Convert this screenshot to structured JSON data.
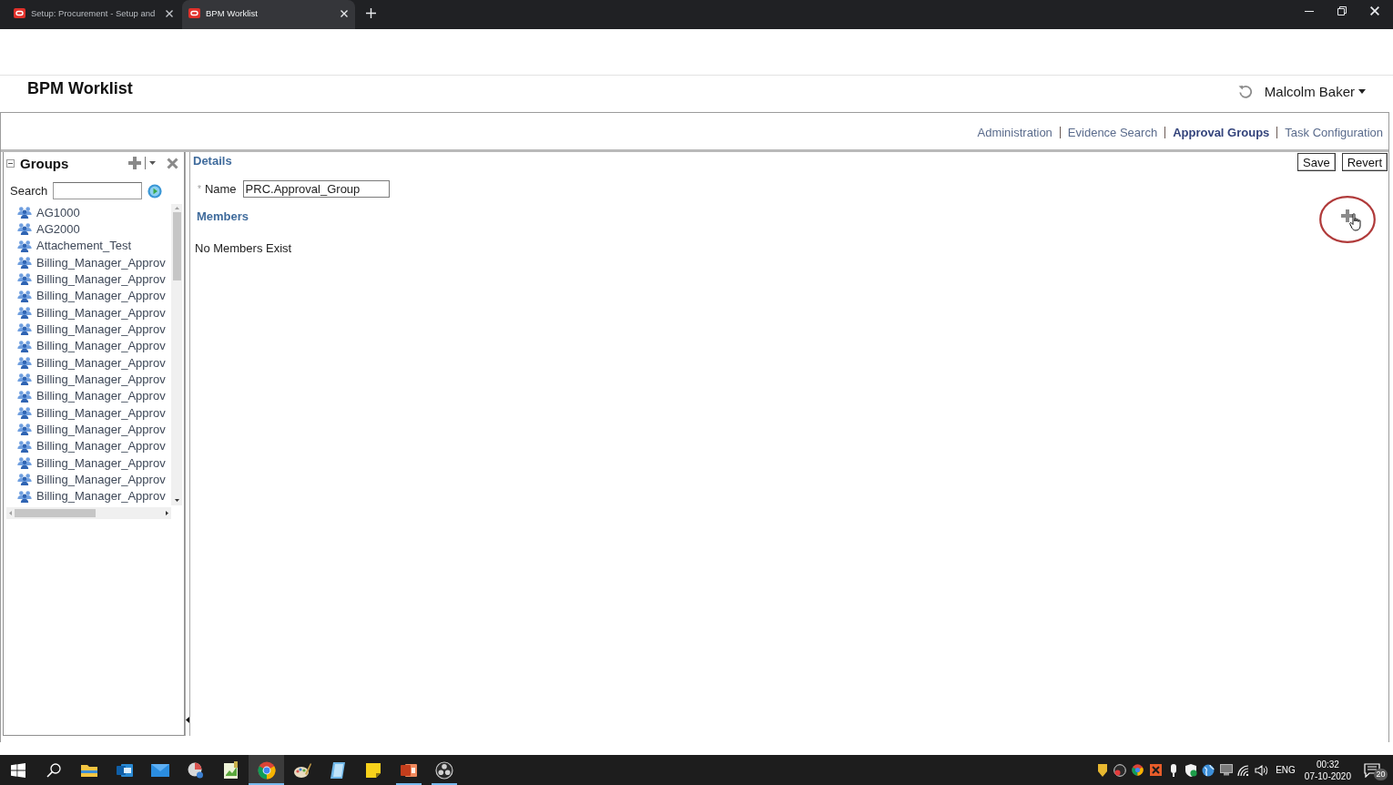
{
  "browser": {
    "tabs": [
      {
        "title": "Setup: Procurement - Setup and",
        "selected": false
      },
      {
        "title": "BPM Worklist",
        "selected": true
      }
    ]
  },
  "header": {
    "title": "BPM Worklist",
    "user": "Malcolm Baker"
  },
  "nav": {
    "links": [
      {
        "label": "Administration",
        "selected": false
      },
      {
        "label": "Evidence Search",
        "selected": false
      },
      {
        "label": "Approval Groups",
        "selected": true
      },
      {
        "label": "Task Configuration",
        "selected": false
      }
    ]
  },
  "groups": {
    "title": "Groups",
    "search_label": "Search",
    "items": [
      {
        "name": "AG1000",
        "selected": false
      },
      {
        "name": "AG2000",
        "selected": false
      },
      {
        "name": "Attachement_Test",
        "selected": false
      },
      {
        "name": "Billing_Manager_Approv",
        "selected": false
      },
      {
        "name": "Billing_Manager_Approv",
        "selected": false
      },
      {
        "name": "Billing_Manager_Approv",
        "selected": false
      },
      {
        "name": "Billing_Manager_Approv",
        "selected": false
      },
      {
        "name": "Billing_Manager_Approv",
        "selected": false
      },
      {
        "name": "Billing_Manager_Approv",
        "selected": false
      },
      {
        "name": "Billing_Manager_Approv",
        "selected": false
      },
      {
        "name": "Billing_Manager_Approv",
        "selected": false
      },
      {
        "name": "Billing_Manager_Approv",
        "selected": false
      },
      {
        "name": "Billing_Manager_Approv",
        "selected": false
      },
      {
        "name": "Billing_Manager_Approv",
        "selected": false
      },
      {
        "name": "Billing_Manager_Approv",
        "selected": false
      },
      {
        "name": "Billing_Manager_Approv",
        "selected": false
      },
      {
        "name": "Billing_Manager_Approv",
        "selected": false
      },
      {
        "name": "Billing_Manager_Approv",
        "selected": false
      }
    ]
  },
  "details": {
    "title": "Details",
    "buttons": [
      "Save",
      "Revert"
    ],
    "required_mark": "*",
    "name_label": "Name",
    "name_value": "PRC.Approval_Group",
    "members_title": "Members",
    "empty_message": "No Members Exist"
  },
  "taskbar": {
    "apps": [
      {
        "running": false,
        "selected": false
      },
      {
        "running": false,
        "selected": false
      },
      {
        "running": false,
        "selected": false
      },
      {
        "running": false,
        "selected": false
      },
      {
        "running": false,
        "selected": false
      },
      {
        "running": true,
        "selected": true
      },
      {
        "running": false,
        "selected": false
      },
      {
        "running": false,
        "selected": false
      },
      {
        "running": false,
        "selected": false
      },
      {
        "running": true,
        "selected": false
      },
      {
        "running": true,
        "selected": false
      }
    ],
    "language": "ENG",
    "time": "00:32",
    "date": "07-10-2020",
    "notifications": "20"
  }
}
